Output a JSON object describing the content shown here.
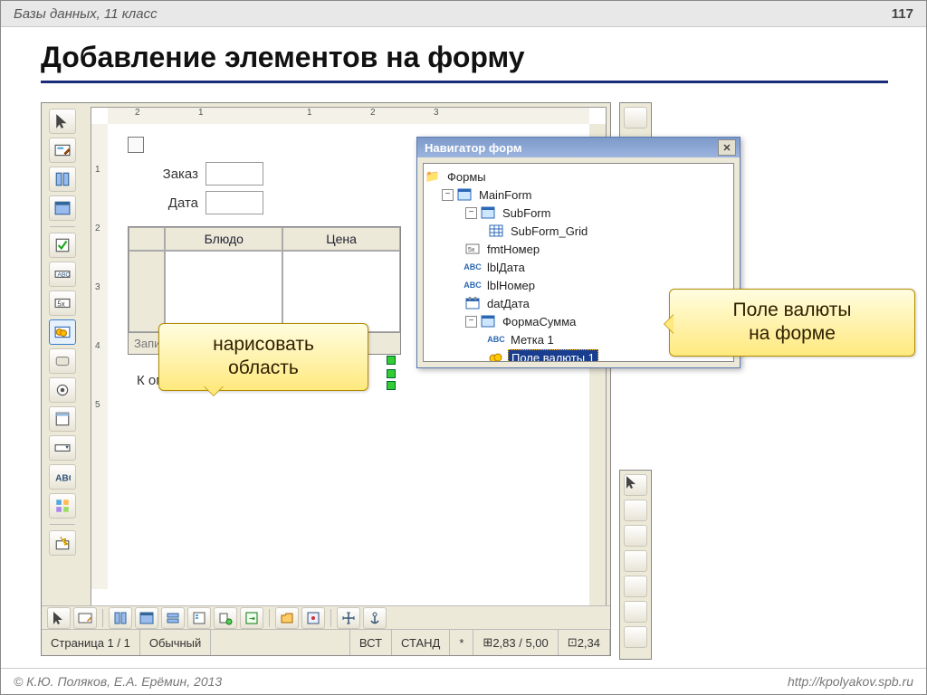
{
  "header": {
    "breadcrumb": "Базы данных, 11 класс",
    "page_number": "117"
  },
  "title": "Добавление элементов на форму",
  "footer": {
    "copyright": "© К.Ю. Поляков, Е.А. Ерёмин, 2013",
    "url": "http://kpolyakov.spb.ru"
  },
  "ruler_h": [
    "2",
    "1",
    "1",
    "2",
    "3"
  ],
  "ruler_v": [
    "1",
    "2",
    "3",
    "4",
    "5"
  ],
  "form": {
    "label_order": "Заказ",
    "label_date": "Дата",
    "label_pay": "К оплате",
    "grid": {
      "col1": "Блюдо",
      "col2": "Цена",
      "record": "Запись"
    }
  },
  "callouts": {
    "draw_area_l1": "нарисовать",
    "draw_area_l2": "область",
    "currency_l1": "Поле валюты",
    "currency_l2": "на форме"
  },
  "navigator": {
    "title": "Навигатор форм",
    "root": "Формы",
    "mainform": "MainForm",
    "subform": "SubForm",
    "subform_grid": "SubForm_Grid",
    "fmt_nomer": "fmtНомер",
    "lbl_data": "lblДата",
    "lbl_nomer": "lblНомер",
    "dat_data": "datДата",
    "form_sum": "ФормаСумма",
    "metka1": "Метка 1",
    "currency_field": "Поле валюты 1"
  },
  "statusbar": {
    "page": "Страница  1 / 1",
    "mode": "Обычный",
    "ins": "ВСТ",
    "std": "СТАНД",
    "mod": "*",
    "coords": "2,83 / 5,00",
    "size": "2,34"
  }
}
